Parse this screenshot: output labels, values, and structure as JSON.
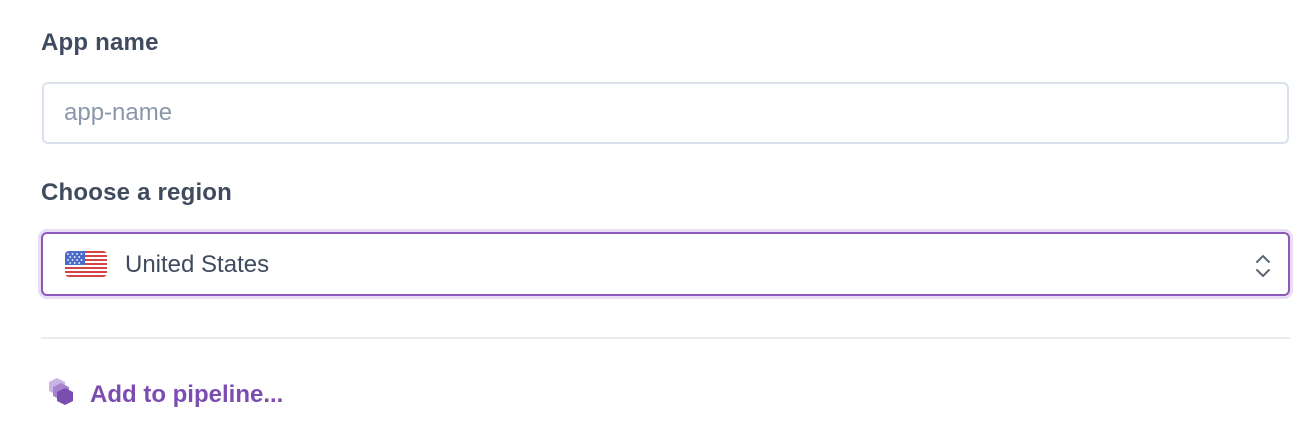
{
  "form": {
    "app_name": {
      "label": "App name",
      "value": "",
      "placeholder": "app-name"
    },
    "region": {
      "label": "Choose a region",
      "selected": "United States",
      "flag_icon": "us-flag-icon",
      "chevron_icon": "chevron-up-down-icon"
    },
    "pipeline": {
      "label": "Add to pipeline...",
      "icon": "pipeline-icon"
    }
  },
  "colors": {
    "label_text": "#3f4b5e",
    "placeholder_text": "#8a97ab",
    "input_border": "#d9e2ec",
    "focus_border": "#8b5ab8",
    "focus_ring": "#e8dcf6",
    "link_purple": "#7b4db0",
    "divider": "#e9edf2"
  }
}
